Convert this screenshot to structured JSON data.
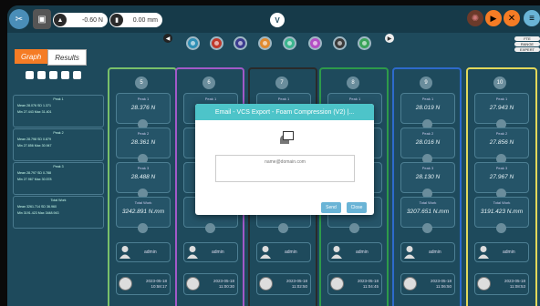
{
  "topbar": {
    "force_value": "-0.60 N",
    "distance_value": "0.00 mm"
  },
  "tabs": [
    {
      "label": "Graph",
      "active": true
    },
    {
      "label": "Results",
      "active": false
    }
  ],
  "station_dots": [
    {
      "color": "#2f8fb5"
    },
    {
      "color": "#c0392b"
    },
    {
      "color": "#3b3b8e"
    },
    {
      "color": "#e08a2f"
    },
    {
      "color": "#3bb58e"
    },
    {
      "color": "#b44fc4"
    },
    {
      "color": "#3a3a3a"
    },
    {
      "color": "#3aa35a"
    }
  ],
  "right_small_labels": [
    "FTE",
    "RANGE",
    "EXPERT"
  ],
  "summary": [
    {
      "title": "Peak 1",
      "line1": "Mean 28.076  SD 1.371",
      "line2": "Min 27.443  Max 31.401"
    },
    {
      "title": "Peak 2",
      "line1": "Mean 28.798  SD 0.879",
      "line2": "Min 27.856  Max 30.947"
    },
    {
      "title": "Peak 3",
      "line1": "Mean 28.797  SD 0.788",
      "line2": "Min 27.967  Max 30.578"
    },
    {
      "title": "Total Work",
      "line1": "Mean 3261.714  SD 36.960",
      "line2": "Min 3191.423  Max 3448.943"
    }
  ],
  "columns": [
    {
      "number": "5",
      "border": "#79c06a",
      "peak1": "28.376 N",
      "peak2": "28.361 N",
      "peak3": "28.488 N",
      "work": "3242.891 N.mm",
      "user": "admin",
      "date": "2023-05-18",
      "time": "10:58:17"
    },
    {
      "number": "6",
      "border": "#a259c8",
      "peak1": "",
      "peak2": "",
      "peak3": "",
      "work": "",
      "user": "admin",
      "date": "2023-05-18",
      "time": "11:00:30"
    },
    {
      "number": "7",
      "border": "#2a2a2a",
      "peak1": "",
      "peak2": "",
      "peak3": "",
      "work": "",
      "user": "admin",
      "date": "2023-05-18",
      "time": "11:02:50"
    },
    {
      "number": "8",
      "border": "#2d9a4a",
      "peak1": "",
      "peak2": "",
      "peak3": "",
      "work": "",
      "user": "admin",
      "date": "2023-05-18",
      "time": "11:04:45"
    },
    {
      "number": "9",
      "border": "#2d6acb",
      "peak1": "28.019 N",
      "peak2": "28.016 N",
      "peak3": "28.130 N",
      "work": "3207.651 N.mm",
      "user": "admin",
      "date": "2023-05-18",
      "time": "11:06:50"
    },
    {
      "number": "10",
      "border": "#e2d85a",
      "peak1": "27.943 N",
      "peak2": "27.856 N",
      "peak3": "27.967 N",
      "work": "3191.423 N.mm",
      "user": "admin",
      "date": "2023-05-18",
      "time": "11:08:53"
    }
  ],
  "card_labels": {
    "peak1": "Peak 1",
    "peak2": "Peak 2",
    "peak3": "Peak 3",
    "work": "Total Work"
  },
  "modal": {
    "title": "Email - VCS Export - Foam Compression (V2) |...",
    "placeholder": "name@domain.com",
    "send_label": "Send",
    "close_label": "Close"
  }
}
